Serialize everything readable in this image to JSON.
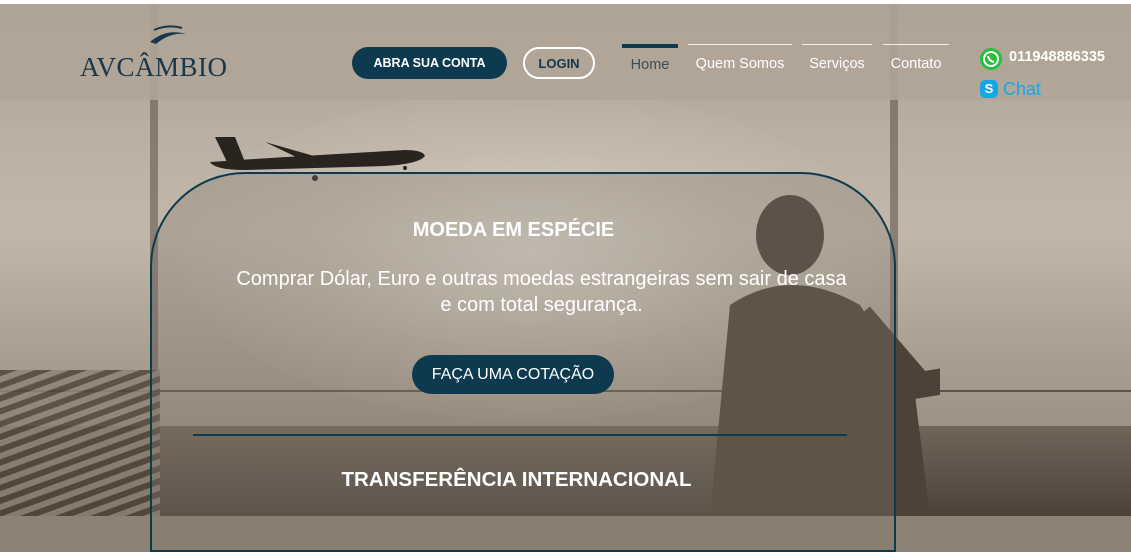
{
  "header": {
    "logo_text": "AVCÂMBIO",
    "open_account_label": "ABRA SUA CONTA",
    "login_label": "LOGIN",
    "nav": [
      {
        "label": "Home",
        "active": true
      },
      {
        "label": "Quem Somos",
        "active": false
      },
      {
        "label": "Serviços",
        "active": false
      },
      {
        "label": "Contato",
        "active": false
      }
    ],
    "phone": "011948886335",
    "chat_label": "Chat"
  },
  "hero": {
    "title": "MOEDA EM ESPÉCIE",
    "text": "Comprar Dólar, Euro e outras moedas estrangeiras sem sair de casa e com total segurança.",
    "cta_label": "FAÇA UMA COTAÇÃO",
    "next_title": "TRANSFERÊNCIA INTERNACIONAL"
  },
  "icons": [
    "logo-plane-icon",
    "whatsapp-icon",
    "skype-icon"
  ],
  "colors": {
    "brand": "#0e3a4f",
    "whatsapp": "#25c03a",
    "skype": "#12a8e8"
  }
}
